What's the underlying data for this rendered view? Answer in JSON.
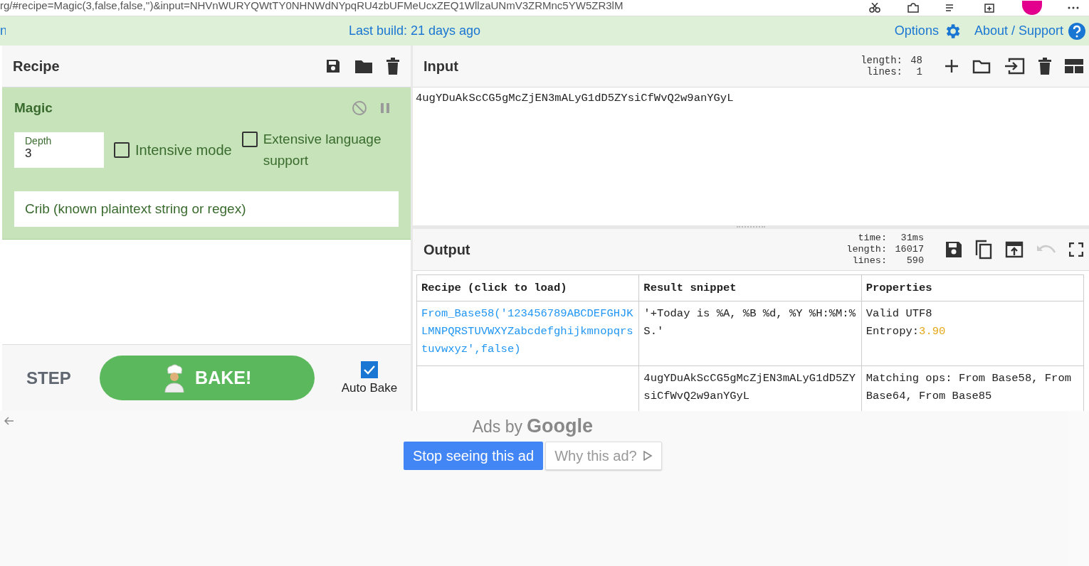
{
  "browser": {
    "url": "rg/#recipe=Magic(3,false,false,'')&input=NHVnWURYQWtTY0NHNWdNYpqRU4zbUFMeUcxZEQ1WllzaUNmV3ZRMnc5YW5ZR3lM"
  },
  "banner": {
    "edge_text": "n",
    "build": "Last build: 21 days ago",
    "options": "Options",
    "about": "About / Support"
  },
  "recipe": {
    "title": "Recipe",
    "operations": [
      {
        "name": "Magic",
        "args": [
          {
            "kind": "number",
            "label": "Depth",
            "value": "3"
          },
          {
            "kind": "checkbox",
            "label": "Intensive mode",
            "checked": false
          },
          {
            "kind": "checkbox",
            "label": "Extensive language support",
            "checked": false
          },
          {
            "kind": "text",
            "placeholder": "Crib (known plaintext string or regex)"
          }
        ]
      }
    ],
    "step": "STEP",
    "bake": "BAKE!",
    "auto_bake": {
      "label": "Auto Bake",
      "checked": true
    }
  },
  "input": {
    "title": "Input",
    "stats": [
      {
        "label": "length:",
        "value": "48"
      },
      {
        "label": "lines:",
        "value": "1"
      }
    ],
    "text": "4ugYDuAkScCG5gMcZjEN3mALyG1dD5ZYsiCfWvQ2w9anYGyL"
  },
  "output": {
    "title": "Output",
    "stats": [
      {
        "label": "time:",
        "value": "31ms"
      },
      {
        "label": "length:",
        "value": "16017"
      },
      {
        "label": "lines:",
        "value": "590"
      }
    ],
    "undo_disabled": true,
    "columns": [
      "Recipe (click to load)",
      "Result snippet",
      "Properties"
    ],
    "rows": [
      {
        "recipe": "From_Base58('123456789ABCDEFGHJKLMNPQRSTUVWXYZabcdefghijkmnopqrstuvwxyz',false)",
        "snippet": "'+Today is %A, %B %d, %Y %H:%M:%S.'",
        "properties": [
          {
            "text": "Valid UTF8"
          },
          {
            "text": "Entropy:",
            "value": "3.90"
          }
        ]
      },
      {
        "snippet": "4ugYDuAkScCG5gMcZjEN3mALyG1dD5ZYsiCfWvQ2w9anYGyL",
        "properties": [
          {
            "text": "Matching ops: From Base58, From Base64, From Base85"
          }
        ]
      }
    ]
  },
  "ad": {
    "prefix": "Ads by",
    "brand": "Google",
    "stop": "Stop seeing this ad",
    "why": "Why this ad?"
  }
}
